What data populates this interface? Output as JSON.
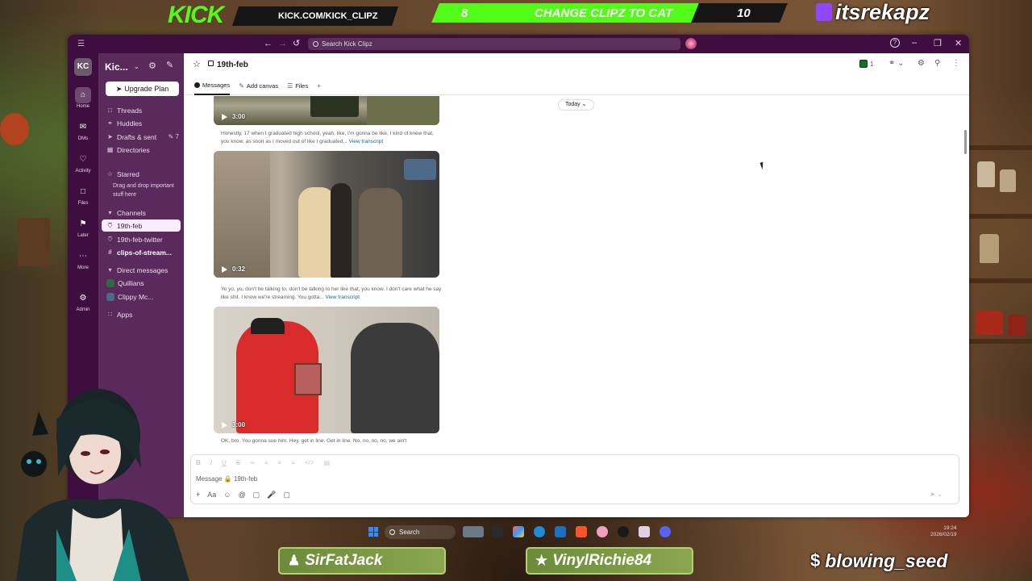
{
  "overlay": {
    "kick_logo": "KICK",
    "kick_url": "KICK.COM/KICK_CLIPZ",
    "goal_current": "8",
    "goal_title": "CHANGE CLIPZ TO CAT",
    "goal_target": "10",
    "twitch_handle": "itsrekapz",
    "chat_users": [
      "SirFatJack",
      "VinylRichie84",
      "blowing_seed"
    ]
  },
  "titlebar": {
    "search_placeholder": "Search Kick Clipz"
  },
  "rail": {
    "workspace_initials": "KC",
    "items": [
      {
        "label": "Home",
        "icon": "home-icon",
        "active": true
      },
      {
        "label": "DMs",
        "icon": "dm-icon"
      },
      {
        "label": "Activity",
        "icon": "bell-icon"
      },
      {
        "label": "Files",
        "icon": "files-icon"
      },
      {
        "label": "Later",
        "icon": "bookmark-icon"
      },
      {
        "label": "More",
        "icon": "more-icon"
      },
      {
        "label": "Admin",
        "icon": "admin-gear-icon"
      }
    ]
  },
  "sidebar": {
    "workspace_name": "Kic...",
    "upgrade_label": "Upgrade Plan",
    "nav": [
      {
        "label": "Threads",
        "icon": "threads-icon"
      },
      {
        "label": "Huddles",
        "icon": "headphones-icon"
      },
      {
        "label": "Drafts & sent",
        "icon": "send-icon",
        "badge": "7"
      },
      {
        "label": "Directories",
        "icon": "directory-icon"
      }
    ],
    "starred_label": "Starred",
    "starred_hint": "Drag and drop important stuff here",
    "channels_label": "Channels",
    "channels": [
      {
        "label": "19th-feb",
        "selected": true
      },
      {
        "label": "19th-feb-twitter"
      },
      {
        "label": "clips-of-stream...",
        "bold": true
      }
    ],
    "dm_label": "Direct messages",
    "dms": [
      "Quillians",
      "Clippy Mc..."
    ],
    "apps_label": "Apps"
  },
  "channel": {
    "name": "19th-feb",
    "member_count": "1",
    "tabs": [
      "Messages",
      "Add canvas",
      "Files"
    ],
    "date_divider": "Today"
  },
  "messages": [
    {
      "duration": "3:00",
      "caption": "Honestly, 17 when I graduated high school, yeah, like, I'm gonna be like, I kind of knew that, you know, as soon as I moved out of like I graduated...",
      "transcript_link": "View transcript"
    },
    {
      "duration": "0:32",
      "caption": "Yo yo, yo, don't be talking to, don't be talking to her like that, you know. I don't care what he say like shit. I know we're streaming. You gotta...",
      "transcript_link": "View transcript"
    },
    {
      "duration": "3:00",
      "caption": "OK, bro. You gonna sue him. Hey, get in line. Get in line. No, no, no, no, we ain't",
      "transcript_link": ""
    }
  ],
  "composer": {
    "placeholder": "Message 🔒 19th-feb"
  },
  "taskbar": {
    "search_label": "Search",
    "time": "19:24",
    "date": "2026/02/19"
  }
}
